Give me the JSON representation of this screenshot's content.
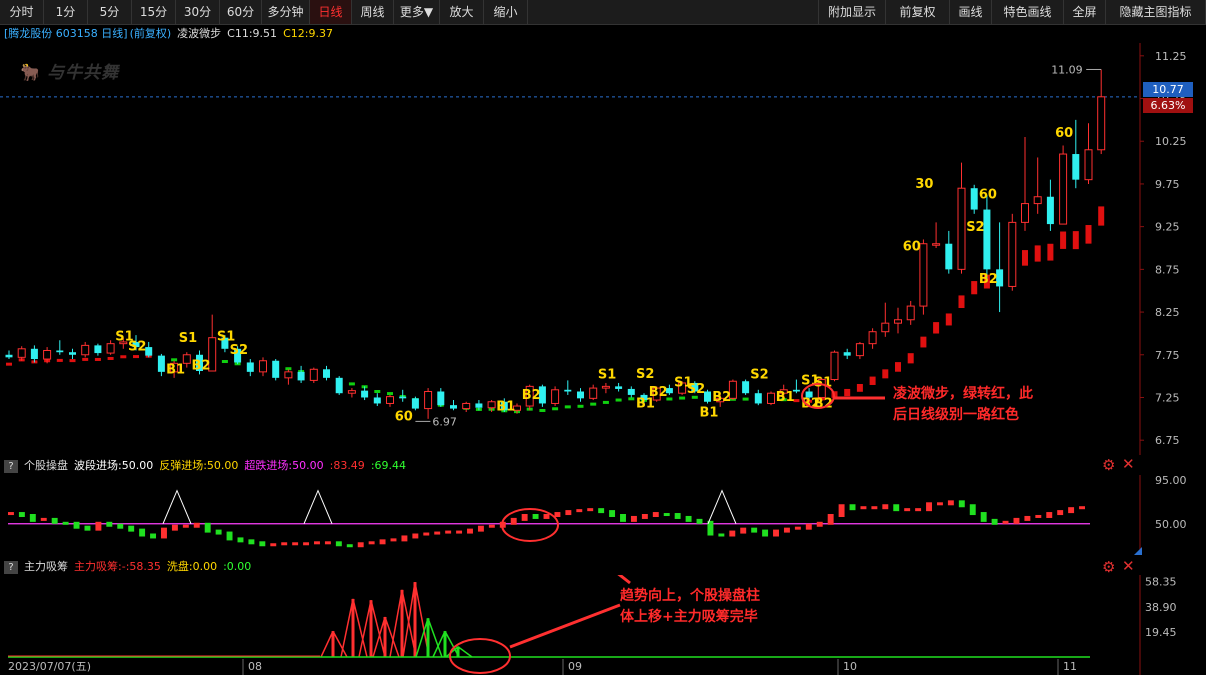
{
  "toolbar": {
    "periods": [
      {
        "label": "分时"
      },
      {
        "label": "1分"
      },
      {
        "label": "5分"
      },
      {
        "label": "15分"
      },
      {
        "label": "30分"
      },
      {
        "label": "60分"
      },
      {
        "label": "多分钟"
      },
      {
        "label": "日线",
        "active": true
      },
      {
        "label": "周线"
      },
      {
        "label": "更多▼"
      },
      {
        "label": "放大"
      },
      {
        "label": "缩小"
      }
    ],
    "right": [
      {
        "label": "附加显示"
      },
      {
        "label": "前复权"
      },
      {
        "label": "画线"
      },
      {
        "label": "特色画线"
      },
      {
        "label": "全屏"
      },
      {
        "label": "隐藏主图指标"
      }
    ]
  },
  "main_info": {
    "stock": "[腾龙股份 603158 日线]",
    "adjust": "(前复权)",
    "indicator": "凌波微步",
    "c11": "C11:9.51",
    "c12": "C12:9.37",
    "watermark": "与牛共舞"
  },
  "price": {
    "current": "10.77",
    "change_pct": "6.63%",
    "high_marker": "11.09",
    "low_marker": "6.97",
    "current_color": "#1f5fbf",
    "pct_color": "#a01010"
  },
  "panel2_info": {
    "name": "个股操盘",
    "l1": "波段进场:50.00",
    "l2": "反弹进场:50.00",
    "l3": "超跌进场:50.00",
    "v1": ":83.49",
    "v2": ":69.44"
  },
  "panel3_info": {
    "name": "主力吸筹",
    "l1": "主力吸筹:",
    "v1": "-:58.35",
    "l2": "洗盘:0.00",
    "v2": ":0.00"
  },
  "annotations": {
    "a1_line1": "凌波微步，绿转红，此",
    "a1_line2": "后日线级别一路红色",
    "a2_line1": "趋势向上，个股操盘柱",
    "a2_line2": "体上移+主力吸筹完毕"
  },
  "date_axis": {
    "start": "2023/07/07(五)",
    "months": [
      "08",
      "09",
      "10",
      "11"
    ]
  },
  "chart_data": [
    {
      "type": "candlestick",
      "title": "腾龙股份 603158 日线",
      "y_ticks": [
        "11.25",
        "10.75",
        "10.25",
        "9.75",
        "9.25",
        "8.75",
        "8.25",
        "7.75",
        "7.25",
        "6.75"
      ],
      "ylim": [
        6.6,
        11.4
      ],
      "candles": [
        [
          7.75,
          7.8,
          7.7,
          7.72
        ],
        [
          7.72,
          7.85,
          7.68,
          7.82
        ],
        [
          7.82,
          7.86,
          7.66,
          7.7
        ],
        [
          7.7,
          7.84,
          7.65,
          7.8
        ],
        [
          7.8,
          7.92,
          7.75,
          7.78
        ],
        [
          7.78,
          7.82,
          7.7,
          7.75
        ],
        [
          7.75,
          7.9,
          7.72,
          7.86
        ],
        [
          7.86,
          7.88,
          7.74,
          7.77
        ],
        [
          7.77,
          7.92,
          7.75,
          7.88
        ],
        [
          7.88,
          7.95,
          7.82,
          7.9
        ],
        [
          7.9,
          7.98,
          7.8,
          7.84
        ],
        [
          7.84,
          7.9,
          7.72,
          7.74
        ],
        [
          7.74,
          7.76,
          7.5,
          7.55
        ],
        [
          7.55,
          7.68,
          7.48,
          7.65
        ],
        [
          7.65,
          7.78,
          7.6,
          7.75
        ],
        [
          7.75,
          7.8,
          7.52,
          7.56
        ],
        [
          7.56,
          8.22,
          7.7,
          7.95
        ],
        [
          7.95,
          7.98,
          7.78,
          7.82
        ],
        [
          7.82,
          7.85,
          7.64,
          7.66
        ],
        [
          7.66,
          7.7,
          7.5,
          7.55
        ],
        [
          7.55,
          7.72,
          7.5,
          7.68
        ],
        [
          7.68,
          7.7,
          7.45,
          7.48
        ],
        [
          7.48,
          7.58,
          7.4,
          7.55
        ],
        [
          7.55,
          7.62,
          7.42,
          7.45
        ],
        [
          7.45,
          7.6,
          7.42,
          7.58
        ],
        [
          7.58,
          7.62,
          7.45,
          7.48
        ],
        [
          7.48,
          7.5,
          7.28,
          7.3
        ],
        [
          7.3,
          7.36,
          7.25,
          7.33
        ],
        [
          7.33,
          7.38,
          7.22,
          7.25
        ],
        [
          7.25,
          7.3,
          7.15,
          7.18
        ],
        [
          7.18,
          7.28,
          7.14,
          7.26
        ],
        [
          7.26,
          7.34,
          7.2,
          7.24
        ],
        [
          7.24,
          7.26,
          7.1,
          7.12
        ],
        [
          7.12,
          7.36,
          7.0,
          7.32
        ],
        [
          7.32,
          7.36,
          7.14,
          7.16
        ],
        [
          7.16,
          7.22,
          7.1,
          7.12
        ],
        [
          7.12,
          7.2,
          7.08,
          7.18
        ],
        [
          7.18,
          7.22,
          7.1,
          7.13
        ],
        [
          7.13,
          7.22,
          7.08,
          7.2
        ],
        [
          7.2,
          7.24,
          7.08,
          7.1
        ],
        [
          7.1,
          7.18,
          7.06,
          7.15
        ],
        [
          7.15,
          7.4,
          7.1,
          7.38
        ],
        [
          7.38,
          7.4,
          7.14,
          7.18
        ],
        [
          7.18,
          7.38,
          7.15,
          7.34
        ],
        [
          7.34,
          7.45,
          7.28,
          7.32
        ],
        [
          7.32,
          7.36,
          7.2,
          7.24
        ],
        [
          7.24,
          7.4,
          7.22,
          7.36
        ],
        [
          7.36,
          7.42,
          7.3,
          7.38
        ],
        [
          7.38,
          7.42,
          7.32,
          7.35
        ],
        [
          7.35,
          7.38,
          7.25,
          7.28
        ],
        [
          7.28,
          7.3,
          7.18,
          7.22
        ],
        [
          7.22,
          7.38,
          7.2,
          7.36
        ],
        [
          7.36,
          7.4,
          7.28,
          7.3
        ],
        [
          7.3,
          7.44,
          7.28,
          7.42
        ],
        [
          7.42,
          7.44,
          7.3,
          7.32
        ],
        [
          7.32,
          7.34,
          7.18,
          7.2
        ],
        [
          7.2,
          7.28,
          7.14,
          7.24
        ],
        [
          7.24,
          7.46,
          7.22,
          7.44
        ],
        [
          7.44,
          7.46,
          7.28,
          7.3
        ],
        [
          7.3,
          7.34,
          7.16,
          7.18
        ],
        [
          7.18,
          7.32,
          7.16,
          7.3
        ],
        [
          7.3,
          7.4,
          7.26,
          7.34
        ],
        [
          7.34,
          7.46,
          7.3,
          7.32
        ],
        [
          7.32,
          7.36,
          7.22,
          7.25
        ],
        [
          7.25,
          7.48,
          7.23,
          7.46
        ],
        [
          7.46,
          7.8,
          7.44,
          7.78
        ],
        [
          7.78,
          7.82,
          7.7,
          7.74
        ],
        [
          7.74,
          7.9,
          7.7,
          7.88
        ],
        [
          7.88,
          8.06,
          7.82,
          8.02
        ],
        [
          8.02,
          8.36,
          7.96,
          8.12
        ],
        [
          8.12,
          8.3,
          8.0,
          8.16
        ],
        [
          8.16,
          8.38,
          8.1,
          8.32
        ],
        [
          8.32,
          9.1,
          8.22,
          9.05
        ],
        [
          9.05,
          9.3,
          9.0,
          9.05
        ],
        [
          9.05,
          9.2,
          8.7,
          8.75
        ],
        [
          8.75,
          10.0,
          8.7,
          9.7
        ],
        [
          9.7,
          9.74,
          9.4,
          9.45
        ],
        [
          9.45,
          9.62,
          8.6,
          8.75
        ],
        [
          8.75,
          9.3,
          8.25,
          8.55
        ],
        [
          8.55,
          9.4,
          8.5,
          9.3
        ],
        [
          9.3,
          10.3,
          9.2,
          9.52
        ],
        [
          9.52,
          10.06,
          9.4,
          9.6
        ],
        [
          9.6,
          9.8,
          9.2,
          9.28
        ],
        [
          9.28,
          10.2,
          9.3,
          10.1
        ],
        [
          10.1,
          10.5,
          9.7,
          9.8
        ],
        [
          9.8,
          10.46,
          9.75,
          10.15
        ],
        [
          10.15,
          11.09,
          10.1,
          10.77
        ]
      ],
      "ma_line_colors": {
        "up": "#e01010",
        "down": "#10d010"
      },
      "signal_labels": [
        "S1",
        "S2",
        "B1",
        "S1",
        "B2",
        "S1",
        "S2",
        "S1",
        "B2",
        "B1",
        "S2",
        "B2",
        "B1",
        "S1",
        "S2",
        "B1",
        "S2",
        "B2",
        "S1",
        "B1",
        "B2",
        "S1",
        "B2",
        "60",
        "30",
        "60",
        "S2",
        "B2",
        "60",
        "60"
      ]
    },
    {
      "type": "bar",
      "title": "个股操盘",
      "y_ticks": [
        "95.00",
        "50.00"
      ],
      "ylim": [
        20,
        100
      ],
      "baseline": 50,
      "values": [
        62,
        60,
        55,
        56,
        53,
        52,
        48,
        46,
        52,
        50,
        48,
        45,
        40,
        38,
        46,
        49,
        49,
        51,
        44,
        42,
        36,
        34,
        32,
        30,
        30,
        31,
        31,
        31,
        32,
        32,
        30,
        29,
        31,
        32,
        34,
        35,
        38,
        40,
        41,
        42,
        43,
        43,
        45,
        48,
        49,
        52,
        56,
        60,
        58,
        60,
        62,
        64,
        65,
        66,
        64,
        60,
        55,
        58,
        60,
        62,
        61,
        58,
        55,
        53,
        41,
        40,
        43,
        46,
        44,
        40,
        44,
        46,
        47,
        50,
        52,
        60,
        70,
        67,
        68,
        68,
        70,
        66,
        66,
        66,
        72,
        72,
        74,
        70,
        62,
        55,
        52,
        53,
        56,
        58,
        59,
        62,
        64,
        67,
        68
      ]
    },
    {
      "type": "bar",
      "title": "主力吸筹",
      "y_ticks": [
        "58.35",
        "38.90",
        "19.45"
      ],
      "ylim": [
        0,
        62
      ],
      "values": [
        0,
        0,
        0,
        0,
        0,
        0,
        0,
        0,
        0,
        0,
        0,
        0,
        0,
        0,
        0,
        0,
        0,
        0,
        0,
        0,
        0,
        0,
        0,
        0,
        0,
        0,
        0,
        0,
        0,
        0,
        0,
        0,
        0,
        0,
        0,
        0,
        0,
        0,
        0,
        0,
        0,
        0,
        0,
        0,
        0,
        0,
        0,
        0,
        0,
        0,
        0,
        0,
        0,
        0,
        0,
        0,
        0,
        0,
        0,
        0,
        0,
        0,
        0,
        0,
        0,
        0,
        0,
        0,
        0,
        0,
        0,
        0,
        0,
        0,
        0,
        0,
        0,
        0,
        0,
        0,
        0,
        0,
        0,
        0,
        0,
        0,
        0,
        0
      ]
    }
  ]
}
